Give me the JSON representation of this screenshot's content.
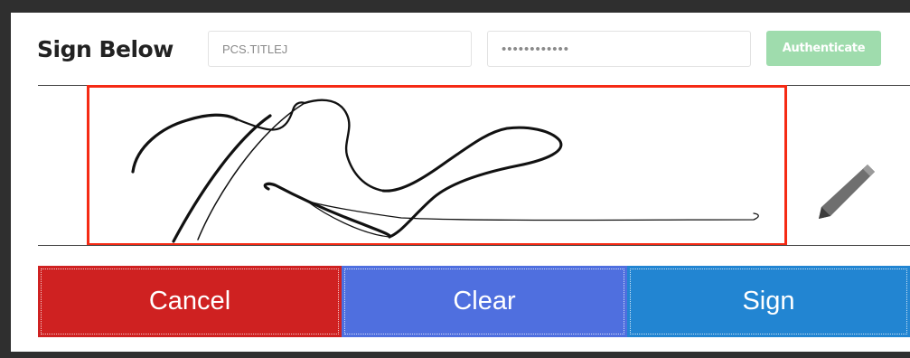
{
  "header": {
    "title": "Sign Below"
  },
  "form": {
    "username_value": "PCS.TITLEJ",
    "password_value": "••••••••••••",
    "authenticate_label": "Authenticate"
  },
  "actions": {
    "cancel_label": "Cancel",
    "clear_label": "Clear",
    "sign_label": "Sign"
  },
  "colors": {
    "signature_border": "#f52a14",
    "authenticate_bg": "#9fdcad",
    "cancel_bg": "#cf2121",
    "clear_bg": "#4f6fdf",
    "sign_bg": "#2285d2"
  },
  "icons": {
    "edit": "pencil-icon"
  }
}
